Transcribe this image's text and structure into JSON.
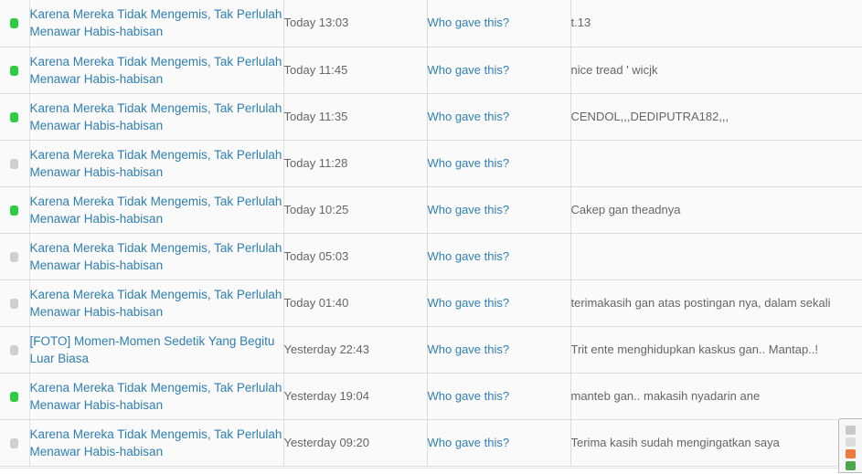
{
  "table": {
    "columns": [
      "status",
      "thread_title",
      "timestamp",
      "who_gave_this",
      "comment"
    ],
    "colors": {
      "link": "#2f7fb5",
      "unread_dot": "#2ecc40",
      "read_dot": "#cfcfcf",
      "row_background": "#fafafa",
      "border": "#dddddd",
      "text": "#666666"
    },
    "rows": [
      {
        "status": "unread",
        "status_icon": "status-dot-icon",
        "title": "Karena Mereka Tidak Mengemis, Tak Perlulah Menawar Habis-habisan",
        "time": "Today 13:03",
        "who": "Who gave this?",
        "comment": "t.13"
      },
      {
        "status": "unread",
        "status_icon": "status-dot-icon",
        "title": "Karena Mereka Tidak Mengemis, Tak Perlulah Menawar Habis-habisan",
        "time": "Today 11:45",
        "who": "Who gave this?",
        "comment": "nice tread ' wicjk"
      },
      {
        "status": "unread",
        "status_icon": "status-dot-icon",
        "title": "Karena Mereka Tidak Mengemis, Tak Perlulah Menawar Habis-habisan",
        "time": "Today 11:35",
        "who": "Who gave this?",
        "comment": "CENDOL,,,DEDIPUTRA182,,,"
      },
      {
        "status": "read",
        "status_icon": "status-dot-icon",
        "title": "Karena Mereka Tidak Mengemis, Tak Perlulah Menawar Habis-habisan",
        "time": "Today 11:28",
        "who": "Who gave this?",
        "comment": ""
      },
      {
        "status": "unread",
        "status_icon": "status-dot-icon",
        "title": "Karena Mereka Tidak Mengemis, Tak Perlulah Menawar Habis-habisan",
        "time": "Today 10:25",
        "who": "Who gave this?",
        "comment": "Cakep gan theadnya"
      },
      {
        "status": "read",
        "status_icon": "status-dot-icon",
        "title": "Karena Mereka Tidak Mengemis, Tak Perlulah Menawar Habis-habisan",
        "time": "Today 05:03",
        "who": "Who gave this?",
        "comment": ""
      },
      {
        "status": "read",
        "status_icon": "status-dot-icon",
        "title": "Karena Mereka Tidak Mengemis, Tak Perlulah Menawar Habis-habisan",
        "time": "Today 01:40",
        "who": "Who gave this?",
        "comment": "terimakasih gan atas postingan nya, dalam sekali"
      },
      {
        "status": "read",
        "status_icon": "status-dot-icon",
        "title": "[FOTO] Momen-Momen Sedetik Yang Begitu Luar Biasa",
        "time": "Yesterday 22:43",
        "who": "Who gave this?",
        "comment": "Trit ente menghidupkan kaskus gan.. Mantap..!"
      },
      {
        "status": "unread",
        "status_icon": "status-dot-icon",
        "title": "Karena Mereka Tidak Mengemis, Tak Perlulah Menawar Habis-habisan",
        "time": "Yesterday 19:04",
        "who": "Who gave this?",
        "comment": "manteb gan.. makasih nyadarin ane"
      },
      {
        "status": "read",
        "status_icon": "status-dot-icon",
        "title": "Karena Mereka Tidak Mengemis, Tak Perlulah Menawar Habis-habisan",
        "time": "Yesterday 09:20",
        "who": "Who gave this?",
        "comment": "Terima kasih sudah mengingatkan saya"
      }
    ]
  },
  "floating_widget": {
    "icons": [
      "toolbar-icon-gray",
      "toolbar-icon-light",
      "toolbar-icon-orange",
      "toolbar-icon-green"
    ]
  }
}
